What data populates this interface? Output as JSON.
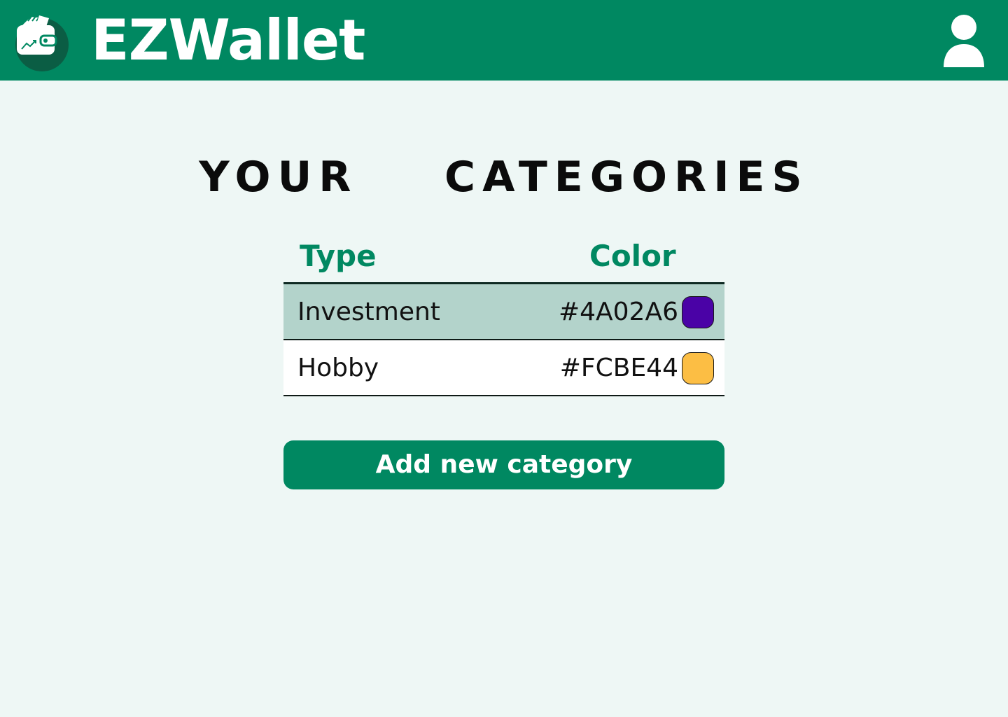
{
  "app": {
    "title": "EZWallet",
    "logo_icon": "wallet-icon",
    "user_icon": "user-icon"
  },
  "page": {
    "heading": "YOUR    CATEGORIES"
  },
  "table": {
    "headers": {
      "type": "Type",
      "color": "Color"
    },
    "rows": [
      {
        "type": "Investment",
        "color": "#4A02A6"
      },
      {
        "type": "Hobby",
        "color": "#FCBE44"
      }
    ]
  },
  "actions": {
    "add_label": "Add new category"
  },
  "colors": {
    "brand": "#008861",
    "page_bg": "#EEF7F5",
    "row_highlight": "#B3D3CB"
  }
}
